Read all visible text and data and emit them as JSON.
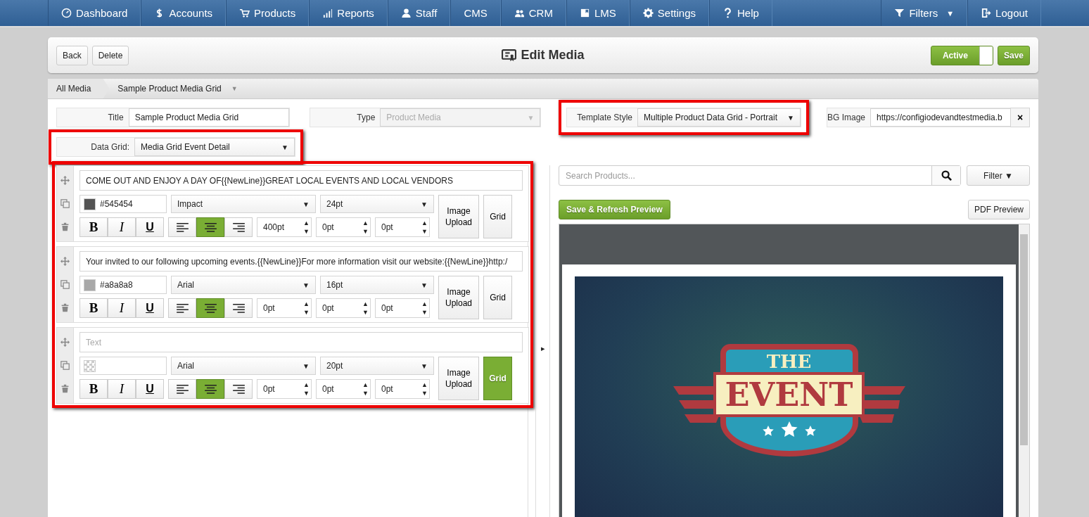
{
  "nav": {
    "left": [
      {
        "label": "Dashboard"
      },
      {
        "label": "Accounts"
      },
      {
        "label": "Products"
      },
      {
        "label": "Reports"
      },
      {
        "label": "Staff"
      },
      {
        "label": "CMS"
      },
      {
        "label": "CRM"
      },
      {
        "label": "LMS"
      },
      {
        "label": "Settings"
      },
      {
        "label": "Help"
      }
    ],
    "right": [
      {
        "label": "Filters",
        "caret": "▼"
      },
      {
        "label": "Logout"
      }
    ]
  },
  "header": {
    "buttons": [
      "Back",
      "Delete"
    ],
    "title": "Edit Media",
    "toggle": {
      "label": "Active",
      "on": true
    },
    "save": "Save"
  },
  "breadcrumb": [
    {
      "label": "All Media"
    },
    {
      "label": "Sample Product Media Grid",
      "caret": "▼"
    }
  ],
  "fields": [
    {
      "label": "Title",
      "value": "Sample Product Media Grid",
      "kind": "text",
      "highlighted": false
    },
    {
      "label": "Type",
      "value": "Product Media",
      "kind": "select",
      "disabled": true,
      "caret": "▼",
      "highlighted": false
    },
    {
      "label": "Template Style",
      "value": "Multiple Product Data Grid - Portrait",
      "kind": "select",
      "disabled": false,
      "caret": "▼",
      "highlighted": true
    },
    {
      "label": "BG Image",
      "value": "https://configiodevandtestmedia.b",
      "kind": "clear",
      "clear": "×",
      "highlighted": false
    }
  ],
  "data_grid": {
    "label": "Data Grid:",
    "value": "Media Grid Event Detail",
    "caret": "▼",
    "highlighted": true
  },
  "layers": [
    {
      "text": "COME OUT AND ENJOY A DAY OF{{NewLine}}GREAT LOCAL EVENTS AND LOCAL VENDORS",
      "color": "#545454",
      "color_text": "#545454",
      "font": "Impact",
      "font_caret": "▼",
      "size": "24pt",
      "size_caret": "▼",
      "bold": "B",
      "italic": "I",
      "underline": "U",
      "spacing": [
        {
          "value": "400pt",
          "up": "▲",
          "down": "▼"
        },
        {
          "value": "0pt",
          "up": "▲",
          "down": "▼"
        },
        {
          "value": "0pt",
          "up": "▲",
          "down": "▼"
        }
      ],
      "align": [
        {
          "selected": false
        },
        {
          "selected": true
        },
        {
          "selected": false
        }
      ],
      "image_upload": "Image Upload",
      "grid": "Grid",
      "grid_on": false
    },
    {
      "text": "Your invited to our following upcoming events.{{NewLine}}For more information visit our website:{{NewLine}}http:/",
      "color": "#a8a8a8",
      "color_text": "#a8a8a8",
      "font": "Arial",
      "font_caret": "▼",
      "size": "16pt",
      "size_caret": "▼",
      "bold": "B",
      "italic": "I",
      "underline": "U",
      "spacing": [
        {
          "value": "0pt",
          "up": "▲",
          "down": "▼"
        },
        {
          "value": "0pt",
          "up": "▲",
          "down": "▼"
        },
        {
          "value": "0pt",
          "up": "▲",
          "down": "▼"
        }
      ],
      "align": [
        {
          "selected": false
        },
        {
          "selected": true
        },
        {
          "selected": false
        }
      ],
      "image_upload": "Image Upload",
      "grid": "Grid",
      "grid_on": false
    },
    {
      "placeholder": "Text",
      "font": "Arial",
      "font_caret": "▼",
      "size": "20pt",
      "size_caret": "▼",
      "bold": "B",
      "italic": "I",
      "underline": "U",
      "spacing": [
        {
          "value": "0pt",
          "up": "▲",
          "down": "▼"
        },
        {
          "value": "0pt",
          "up": "▲",
          "down": "▼"
        },
        {
          "value": "0pt",
          "up": "▲",
          "down": "▼"
        }
      ],
      "align": [
        {
          "selected": false
        },
        {
          "selected": true
        },
        {
          "selected": false
        }
      ],
      "image_upload": "Image Upload",
      "grid": "Grid",
      "grid_on": true
    }
  ],
  "toggle_strip": "▸",
  "search": {
    "placeholder": "Search Products...",
    "filter": "Filter",
    "caret": "▼"
  },
  "preview": {
    "refresh": "Save & Refresh Preview",
    "pdf": "PDF Preview",
    "banner": {
      "top": "THE",
      "main": "EVENT"
    }
  }
}
